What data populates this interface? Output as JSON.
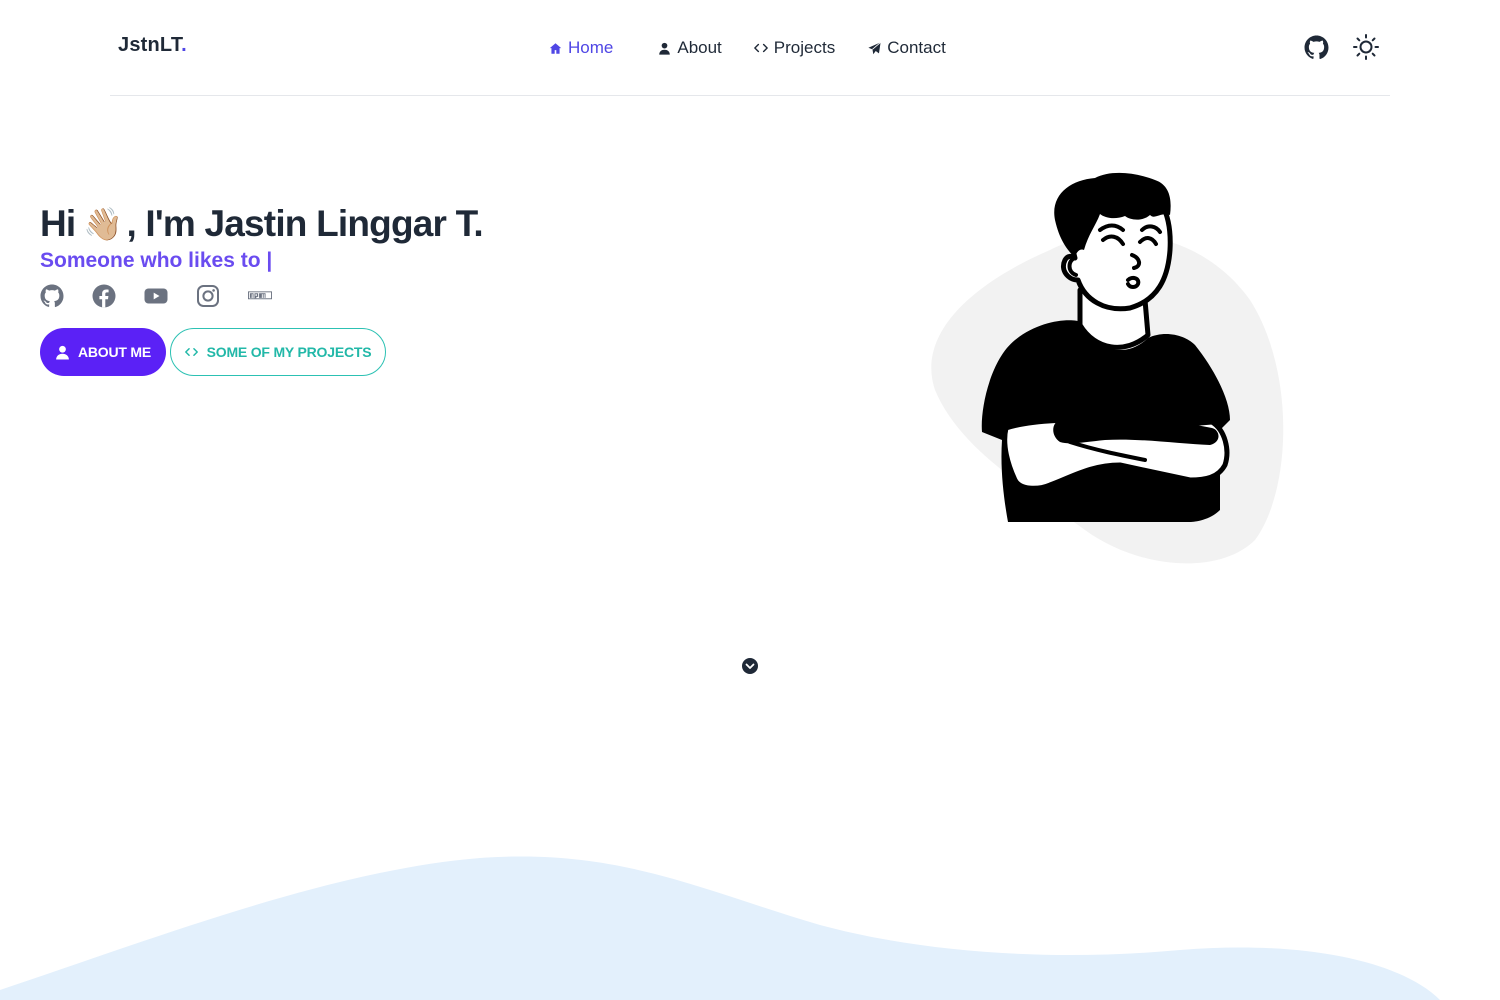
{
  "header": {
    "logo_text": "JstnLT",
    "logo_dot": ".",
    "nav": [
      {
        "label": "Home",
        "icon": "home-icon",
        "active": true
      },
      {
        "label": "About",
        "icon": "user-icon",
        "active": false
      },
      {
        "label": "Projects",
        "icon": "code-icon",
        "active": false
      },
      {
        "label": "Contact",
        "icon": "paper-plane-icon",
        "active": false
      }
    ],
    "icons": [
      "github-icon",
      "sun-icon"
    ]
  },
  "hero": {
    "greeting_prefix": "Hi",
    "wave_emoji": "👋🏼",
    "greeting_suffix": ", I'm Jastin Linggar T.",
    "subtitle": "Someone who likes to |",
    "socials": [
      "github-icon",
      "facebook-icon",
      "youtube-icon",
      "instagram-icon",
      "npm-icon"
    ],
    "buttons": {
      "about_label": "ABOUT ME",
      "projects_label": "SOME OF MY PROJECTS"
    }
  },
  "colors": {
    "accent": "#4f46e5",
    "primary_button": "#5b21f6",
    "secondary_button": "#2cc1b3",
    "subtitle": "#6a4cf0",
    "wave": "#e3f0fc",
    "blob": "#f2f2f2"
  }
}
